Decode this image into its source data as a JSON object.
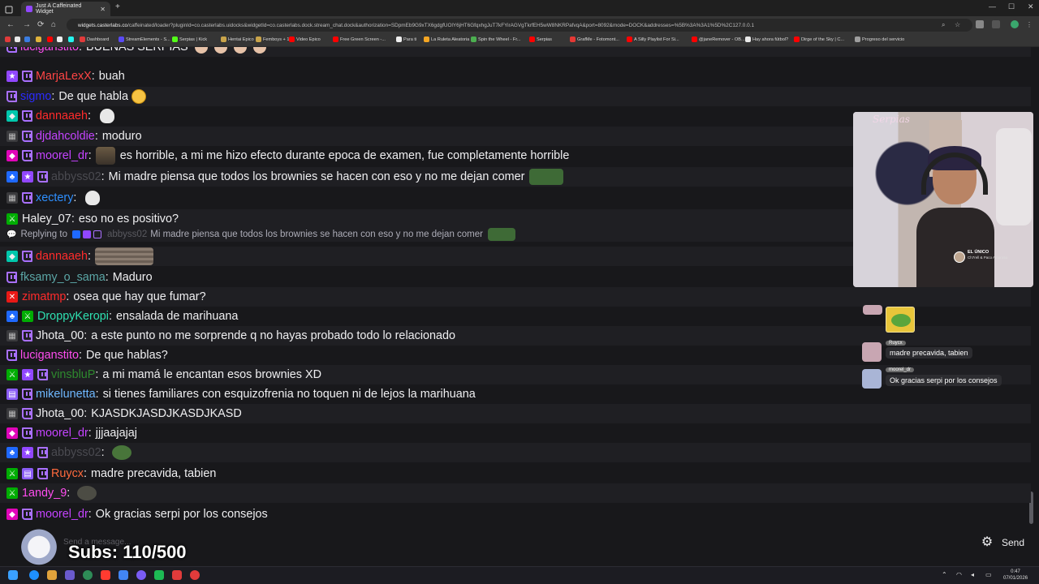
{
  "browser": {
    "tab_title": "Just A Caffeinated Widget",
    "tab_close": "✕",
    "new_tab": "+",
    "url_host": "widgets.casterlabs.co",
    "url_path": "/caffeinated/loader?pluginId=co.casterlabs.uidocks&widgetId=co.casterlabs.dock.stream_chat.dock&authorization=SDpmEb9G9xTX6gdgfUOlY6jHT6GfqxhgJuT7kFYirAGVgTkrfEH5wW8NKRPafvqA&port=8092&mode=DOCK&addresses=%5B%3A%3A1%5D%2C127.0.0.1"
  },
  "bookmarks": [
    {
      "label": "",
      "color": "#e03b3b"
    },
    {
      "label": "",
      "color": "#e9e9e9"
    },
    {
      "label": "",
      "color": "#3b7de0"
    },
    {
      "label": "",
      "color": "#e0b33b"
    },
    {
      "label": "",
      "color": "#ff0000"
    },
    {
      "label": "",
      "color": "#eeeeee"
    },
    {
      "label": "",
      "color": "#25f4ee"
    },
    {
      "label": "Dashboard",
      "color": "#e03b3b"
    },
    {
      "label": "StreamElements - S...",
      "color": "#5a4af5"
    },
    {
      "label": "Serpias | Kick",
      "color": "#53fc18"
    },
    {
      "label": "Hentai Epico",
      "color": "#c9a44a"
    },
    {
      "label": "Femboys + 18",
      "color": "#c9a44a"
    },
    {
      "label": "Video Epico",
      "color": "#ff0000"
    },
    {
      "label": "Free Green Screen -...",
      "color": "#ff0000"
    },
    {
      "label": "Para ti",
      "color": "#eeeeee"
    },
    {
      "label": "La Ruleta Aleatoria",
      "color": "#f5a623"
    },
    {
      "label": "Spin the Wheel - Fr...",
      "color": "#4caf50"
    },
    {
      "label": "Serpias",
      "color": "#ff0000"
    },
    {
      "label": "GrafMe - Fotomont...",
      "color": "#e53935"
    },
    {
      "label": "A Silly Playlist For Si...",
      "color": "#ff0000"
    },
    {
      "label": "@janeRemover - OB...",
      "color": "#ff0000"
    },
    {
      "label": "Hay ahora fútbol?",
      "color": "#e9e9e9"
    },
    {
      "label": "Dirge of the Sky | C...",
      "color": "#ff0000"
    },
    {
      "label": "Progreso del servicio",
      "color": "#9e9e9e"
    }
  ],
  "chat": [
    {
      "badges": [
        "twitch"
      ],
      "name": "luciganstito",
      "color": "#ff4df0",
      "msg": "BUENAS SERPIAS",
      "emotes": [
        "hand",
        "hand",
        "hand",
        "hand"
      ],
      "partial": true
    },
    {
      "badges": [
        "star",
        "twitch"
      ],
      "name": "MarjaLexX",
      "color": "#ff4545",
      "msg": "buah",
      "emotes": []
    },
    {
      "badges": [
        "twitch"
      ],
      "name": "sigmo",
      "color": "#2b2bff",
      "msg": "De que habla",
      "emotes": [
        "face"
      ]
    },
    {
      "badges": [
        "gem",
        "twitch"
      ],
      "name": "dannaaeh",
      "color": "#ff2b2b",
      "msg": "",
      "emotes": [
        "skull"
      ]
    },
    {
      "badges": [
        "grey",
        "twitch"
      ],
      "name": "djdahcoldie",
      "color": "#c443ff",
      "msg": "moduro",
      "emotes": []
    },
    {
      "badges": [
        "vip",
        "twitch"
      ],
      "name": "moorel_dr",
      "color": "#c443ff",
      "msg": "es horrible, a mi me hizo efecto durante epoca de examen, fue completamente horrible",
      "emotes": [
        "photo"
      ],
      "emote_first": true
    },
    {
      "badges": [
        "blue",
        "star",
        "twitch"
      ],
      "name": "abbyss02",
      "color": "#4a4a50",
      "msg": "Mi madre piensa que todos los brownies se hacen con eso y no me dejan comer",
      "emotes": [
        "pepe"
      ]
    },
    {
      "badges": [
        "grey",
        "twitch"
      ],
      "name": "xectery",
      "color": "#2e8fff",
      "msg": "",
      "emotes": [
        "skull"
      ]
    },
    {
      "badges": [
        "mod"
      ],
      "name": "Haley_07",
      "color": "#efeff1",
      "msg": "eso no es positivo?",
      "emotes": []
    },
    {
      "reply": true,
      "label": "Replying to",
      "name": "abbyss02",
      "msg": "Mi madre piensa que todos los brownies se hacen con eso y no me dejan comer"
    },
    {
      "badges": [
        "gem",
        "twitch"
      ],
      "name": "dannaaeh",
      "color": "#ff2b2b",
      "msg": "",
      "emotes": [
        "wood"
      ],
      "emote_first": true
    },
    {
      "badges": [
        "twitch"
      ],
      "name": "fksamy_o_sama",
      "color": "#5ba6a6",
      "msg": "Maduro",
      "emotes": []
    },
    {
      "badges": [
        "red"
      ],
      "name": "zimatmp",
      "color": "#ff2b2b",
      "msg": "osea que hay que fumar?",
      "emotes": []
    },
    {
      "badges": [
        "blue",
        "mod"
      ],
      "name": "DroppyKeropi",
      "color": "#2ee0b0",
      "msg": "ensalada de marihuana",
      "emotes": []
    },
    {
      "badges": [
        "grey",
        "twitch"
      ],
      "name": "Jhota_00",
      "color": "#efeff1",
      "msg": "a este punto no me sorprende q no hayas probado todo lo relacionado",
      "emotes": []
    },
    {
      "badges": [
        "twitch"
      ],
      "name": "luciganstito",
      "color": "#ff4df0",
      "msg": "De que hablas?",
      "emotes": []
    },
    {
      "badges": [
        "mod",
        "star",
        "twitch"
      ],
      "name": "vinsbluP",
      "color": "#2e8a2e",
      "msg": "a mi mamá le encantan esos brownies XD",
      "emotes": []
    },
    {
      "badges": [
        "gift",
        "twitch"
      ],
      "name": "mikelunetta",
      "color": "#6fb8ff",
      "msg": "si tienes familiares con esquizofrenia no toquen ni de lejos la marihuana",
      "emotes": []
    },
    {
      "badges": [
        "grey",
        "twitch"
      ],
      "name": "Jhota_00",
      "color": "#efeff1",
      "msg": "KJASDKJASDJKASDJKASD",
      "emotes": []
    },
    {
      "badges": [
        "vip",
        "twitch"
      ],
      "name": "moorel_dr",
      "color": "#c443ff",
      "msg": "jjjaajajaj",
      "emotes": []
    },
    {
      "badges": [
        "blue",
        "star",
        "twitch"
      ],
      "name": "abbyss02",
      "color": "#4a4a50",
      "msg": "",
      "emotes": [
        "frog"
      ]
    },
    {
      "badges": [
        "mod",
        "gift",
        "twitch"
      ],
      "name": "Ruycx",
      "color": "#ff6a3d",
      "msg": "madre precavida, tabien",
      "emotes": []
    },
    {
      "badges": [
        "mod"
      ],
      "name": "1andy_9",
      "color": "#ff4df0",
      "msg": "",
      "emotes": [
        "stone"
      ]
    },
    {
      "badges": [
        "vip",
        "twitch"
      ],
      "name": "moorel_dr",
      "color": "#c443ff",
      "msg": "Ok gracias serpi por los consejos",
      "emotes": []
    }
  ],
  "overlay": {
    "cam_logo": "Serpias",
    "plate_title": "EL ÚNICO",
    "plate_sub": "Ch7rell & Paco Amoroso",
    "alerts": [
      {
        "name": "Ruycx",
        "msg": "madre precavida, tabien"
      },
      {
        "name": "moorel_dr",
        "msg": "Ok gracias serpi por los consejos"
      }
    ]
  },
  "input": {
    "placeholder": "Send a message...",
    "send_label": "Send",
    "subs_label": "Subs: 110/500"
  },
  "taskbar": {
    "time": "0:47",
    "date": "07/01/2026",
    "apps": [
      "#1e90ff",
      "#e0a23b",
      "#6a5acd",
      "#2e8b57",
      "#ff3b30",
      "#4285f4",
      "#7a5cf5",
      "#1db954",
      "#e03b3b",
      "#e03b3b"
    ]
  }
}
